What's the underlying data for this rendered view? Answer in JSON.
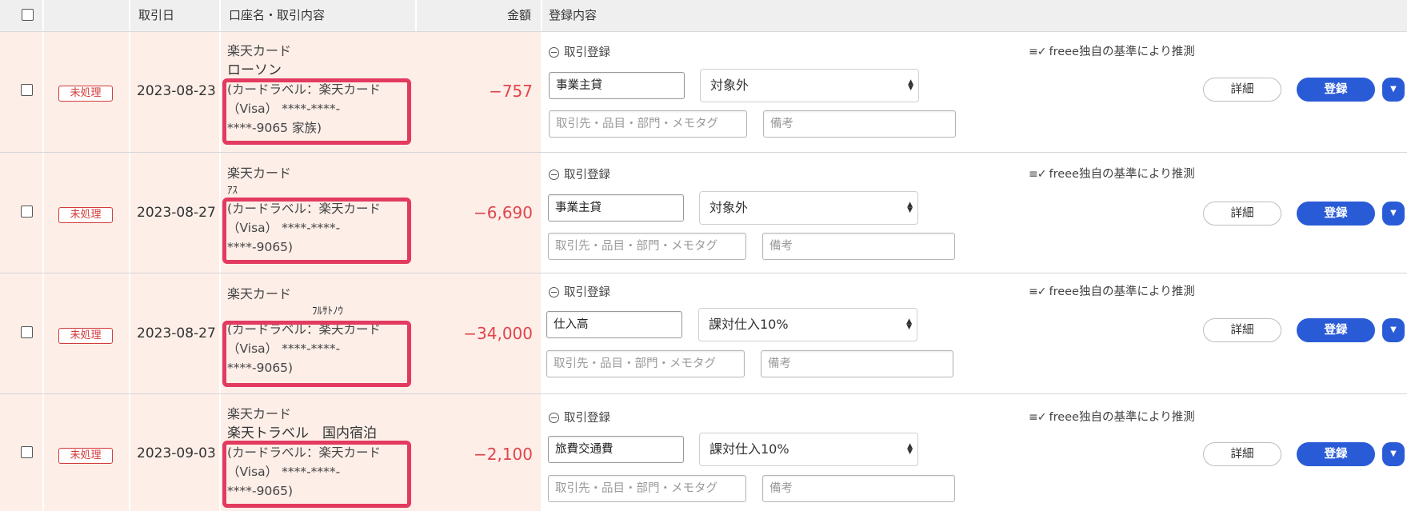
{
  "header": {
    "date": "取引日",
    "account": "口座名・取引内容",
    "amount": "金額",
    "registration": "登録内容"
  },
  "common": {
    "status": "未処理",
    "reg_toggle": "取引登録",
    "guess_text": "freee独自の基準により推測",
    "partner_placeholder": "取引先・品目・部門・メモタグ",
    "memo_placeholder": "備考",
    "detail_button": "詳細",
    "register_button": "登録"
  },
  "rows": [
    {
      "date": "2023-08-23",
      "account_name": "楽天カード",
      "payee": "ローソン",
      "label_lines": [
        "(カードラベル：楽天カード",
        "（Visa） ****-****-",
        "****-9065 家族)"
      ],
      "amount": "−757",
      "category": "事業主貸",
      "tax": "対象外"
    },
    {
      "date": "2023-08-27",
      "account_name": "楽天カード",
      "payee": "ｱｽ",
      "label_lines": [
        "(カードラベル：楽天カード",
        "（Visa） ****-****-",
        "****-9065)"
      ],
      "amount": "−6,690",
      "category": "事業主貸",
      "tax": "対象外"
    },
    {
      "date": "2023-08-27",
      "account_name": "楽天カード",
      "payee": "ﾌﾙｻﾄﾉｳ",
      "label_lines": [
        "(カードラベル：楽天カード",
        "（Visa） ****-****-",
        "****-9065)"
      ],
      "amount": "−34,000",
      "category": "仕入高",
      "tax": "課対仕入10%"
    },
    {
      "date": "2023-09-03",
      "account_name": "楽天カード",
      "payee": "楽天トラベル　国内宿泊",
      "label_lines": [
        "(カードラベル：楽天カード",
        "（Visa） ****-****-",
        "****-9065)"
      ],
      "amount": "−2,100",
      "category": "旅費交通費",
      "tax": "課対仕入10%"
    }
  ]
}
